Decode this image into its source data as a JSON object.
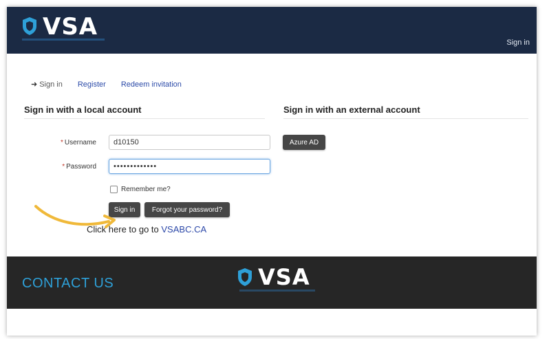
{
  "header": {
    "logo_text": "VSA",
    "signin_link": "Sign in"
  },
  "tabs": [
    {
      "label": "Sign in",
      "icon": "signin-icon",
      "active": true
    },
    {
      "label": "Register"
    },
    {
      "label": "Redeem invitation"
    }
  ],
  "local": {
    "title": "Sign in with a local account",
    "username_label": "Username",
    "username_value": "d10150",
    "password_label": "Password",
    "password_value": "•••••••••••••",
    "remember_label": "Remember me?",
    "signin_button": "Sign in",
    "forgot_button": "Forgot your password?"
  },
  "external": {
    "title": "Sign in with an external account",
    "azure_button": "Azure AD"
  },
  "goto": {
    "text": "Click here to go to ",
    "link": "VSABC.CA"
  },
  "footer": {
    "contact": "CONTACT US",
    "logo_text": "VSA"
  },
  "colors": {
    "header_bg": "#1b2a44",
    "footer_bg": "#262626",
    "accent": "#2ea0d8",
    "button_bg": "#464646",
    "annotation_arrow": "#f0b93a"
  }
}
